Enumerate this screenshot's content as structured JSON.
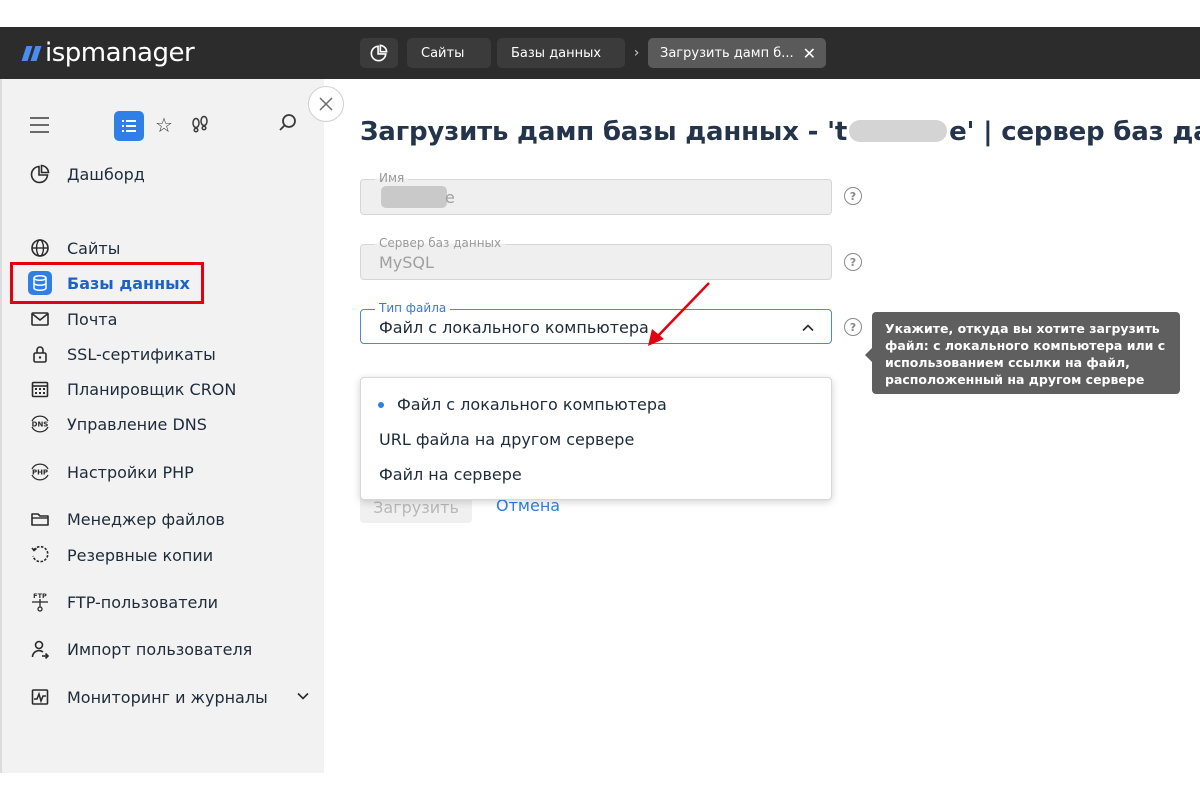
{
  "app": {
    "logo_text": "ispmanager"
  },
  "breadcrumbs": {
    "sites": "Сайты",
    "databases": "Базы данных",
    "active": "Загрузить дамп б..."
  },
  "sidebar": {
    "items": [
      {
        "label": "Дашборд",
        "icon": "dashboard-icon"
      },
      {
        "label": "Сайты",
        "icon": "globe-icon"
      },
      {
        "label": "Базы данных",
        "icon": "database-icon",
        "active": true
      },
      {
        "label": "Почта",
        "icon": "mail-icon"
      },
      {
        "label": "SSL-сертификаты",
        "icon": "lock-icon"
      },
      {
        "label": "Планировщик CRON",
        "icon": "calendar-icon"
      },
      {
        "label": "Управление DNS",
        "icon": "dns-icon"
      },
      {
        "label": "Настройки PHP",
        "icon": "php-icon"
      },
      {
        "label": "Менеджер файлов",
        "icon": "folder-icon"
      },
      {
        "label": "Резервные копии",
        "icon": "backup-icon"
      },
      {
        "label": "FTP-пользователи",
        "icon": "ftp-icon"
      },
      {
        "label": "Импорт пользователя",
        "icon": "user-import-icon"
      },
      {
        "label": "Мониторинг и журналы",
        "icon": "monitoring-icon"
      }
    ],
    "dns_badge": "DNS",
    "php_badge": "PHP",
    "ftp_badge": "FTP"
  },
  "main": {
    "title_prefix": "Загрузить дамп базы данных - 't",
    "title_suffix": "e' | сервер баз данн",
    "fields": {
      "name": {
        "label": "Имя",
        "value_tail": "e"
      },
      "server": {
        "label": "Сервер баз данных",
        "value": "MySQL"
      },
      "file_type": {
        "label": "Тип файла",
        "value": "Файл с локального компьютера"
      }
    },
    "dropdown_options": [
      "Файл с локального компьютера",
      "URL файла на другом сервере",
      "Файл на сервере"
    ],
    "tooltip": "Укажите, откуда вы хотите загрузить файл: с локального компьютера или с использованием ссылки на файл, расположенный на другом сервере",
    "help_glyph": "?",
    "buttons": {
      "load": "Загрузить",
      "cancel": "Отмена"
    }
  },
  "colors": {
    "accent": "#2f7fe6",
    "highlight": "#e3000f",
    "topbar": "#2c2c2c"
  }
}
